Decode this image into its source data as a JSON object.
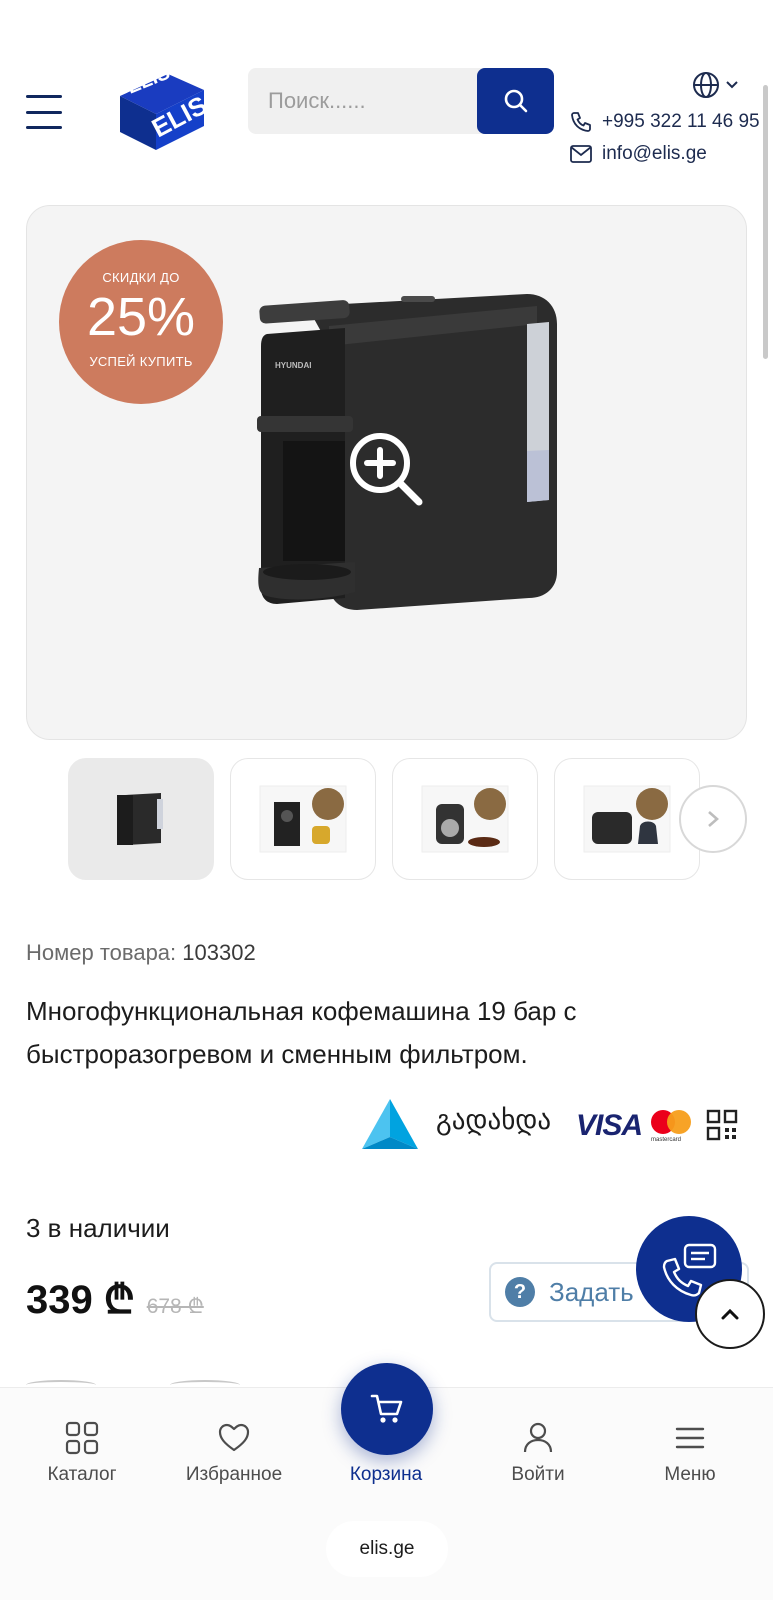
{
  "header": {
    "search_placeholder": "Поиск......",
    "phone": "+995 322 11 46 95",
    "email": "info@elis.ge",
    "logo_text": "ELIS"
  },
  "gallery": {
    "badge_top": "СКИДКИ ДО",
    "badge_value": "25%",
    "badge_bottom": "УСПЕЙ КУПИТЬ",
    "thumbnails_count": 4
  },
  "product": {
    "sku_label": "Номер товара:",
    "sku_value": "103302",
    "title": "Многофункциональная кофемашина 19 бар с быстроразогревом и сменным фильтром.",
    "payment_text": "გადახდა",
    "visa_text": "VISA",
    "mastercard_text": "mastercard",
    "stock": "3 в наличии",
    "price": "339 ₾",
    "old_price": "678 ₾",
    "ask_label": "Задать"
  },
  "bottom_nav": {
    "items": [
      {
        "label": "Каталог",
        "icon": "grid-icon"
      },
      {
        "label": "Избранное",
        "icon": "heart-icon"
      },
      {
        "label": "Корзина",
        "icon": "cart-icon"
      },
      {
        "label": "Войти",
        "icon": "user-icon"
      },
      {
        "label": "Меню",
        "icon": "menu-icon"
      }
    ],
    "domain": "elis.ge"
  },
  "colors": {
    "brand_blue": "#0e2f8f",
    "badge": "#cd7b5e",
    "ask_blue": "#4f7ea7"
  }
}
